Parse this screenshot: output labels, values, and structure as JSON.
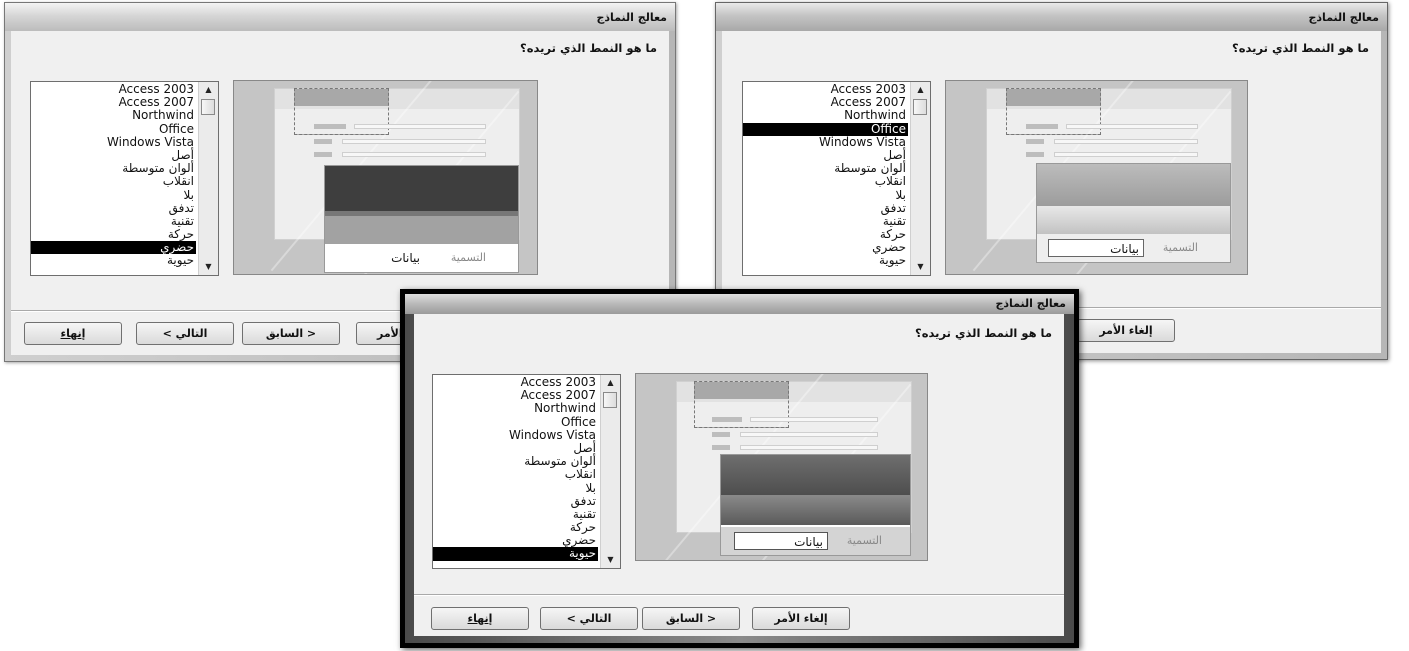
{
  "wizard": {
    "title": "معالج النماذج",
    "question": "ما هو النمط الذي تريده؟",
    "styles": [
      "Access 2003",
      "Access 2007",
      "Northwind",
      "Office",
      "Windows Vista",
      "أصل",
      "ألوان متوسطة",
      "انقلاب",
      "بلا",
      "تدفق",
      "تقنية",
      "حركة",
      "حضري",
      "حيوية"
    ],
    "preview": {
      "caption": "التسمية",
      "data": "بيانات"
    },
    "buttons": {
      "finish": "إنهاء",
      "next": "التالي >",
      "back": "< السابق",
      "cancel": "إلغاء الأمر",
      "cancel_partial": "الأمر"
    }
  },
  "dialogs": {
    "left": {
      "selected_style": "حضري"
    },
    "right": {
      "selected_style": "Office"
    },
    "front": {
      "selected_style": "حيوية"
    }
  }
}
